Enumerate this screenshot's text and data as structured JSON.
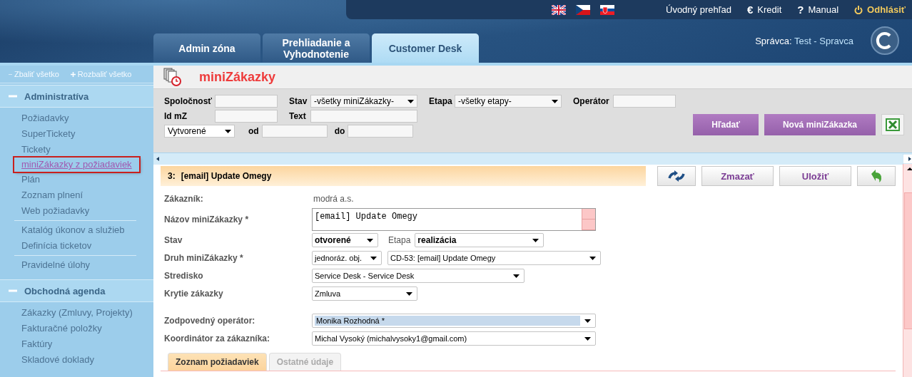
{
  "top_links": [
    {
      "kind": "plain",
      "label": "Úvodný prehľad"
    },
    {
      "kind": "glyph",
      "icon": "€",
      "label": "Kredit"
    },
    {
      "kind": "glyph",
      "icon": "?",
      "label": "Manual"
    },
    {
      "kind": "logout",
      "label": "Odhlásiť"
    }
  ],
  "tabs": [
    {
      "label": "Admin zóna",
      "selected": false
    },
    {
      "label": "Prehliadanie a Vyhodnotenie",
      "selected": false
    },
    {
      "label": "Customer Desk",
      "selected": true
    }
  ],
  "user": {
    "role": "Správca:",
    "name": "Test - Spravca"
  },
  "sidebar": {
    "collapse_all": "Zbaliť všetko",
    "expand_all": "Rozbaliť všetko",
    "sections": [
      {
        "title": "Administratíva",
        "expanded": true,
        "groups": [
          [
            {
              "label": "Požiadavky",
              "selected": false
            },
            {
              "label": "SuperTickety",
              "selected": false
            },
            {
              "label": "Tickety",
              "selected": false
            },
            {
              "label": "miniZákazky z požiadaviek",
              "selected": true
            },
            {
              "label": "Plán",
              "selected": false
            },
            {
              "label": "Zoznam plnení",
              "selected": false
            },
            {
              "label": "Web požiadavky",
              "selected": false
            }
          ],
          [
            {
              "label": "Katalóg úkonov a služieb",
              "selected": false
            },
            {
              "label": "Definícia ticketov",
              "selected": false
            }
          ],
          [
            {
              "label": "Pravidelné úlohy",
              "selected": false
            }
          ]
        ]
      },
      {
        "title": "Obchodná agenda",
        "expanded": true,
        "groups": [
          [
            {
              "label": "Zákazky (Zmluvy, Projekty)",
              "selected": false
            },
            {
              "label": "Fakturačné položky",
              "selected": false
            },
            {
              "label": "Faktúry",
              "selected": false
            },
            {
              "label": "Skladové doklady",
              "selected": false
            }
          ]
        ]
      }
    ]
  },
  "page": {
    "title": "miniZákazky"
  },
  "filters": {
    "fields": [
      {
        "label": "Spoločnosť",
        "kind": "input"
      },
      {
        "label": "Stav",
        "kind": "select",
        "value": "-všetky miniZákazky-"
      },
      {
        "label": "Etapa",
        "kind": "select",
        "value": "-všetky etapy-"
      },
      {
        "label": "Operátor",
        "kind": "input"
      },
      {
        "label": "Id mZ",
        "kind": "input"
      },
      {
        "label": "Text",
        "kind": "input"
      }
    ],
    "date": {
      "select": "Vytvorené",
      "from_label": "od",
      "to_label": "do"
    },
    "buttons": [
      {
        "label": "Hľadať"
      },
      {
        "label": "Nová miniZákazka"
      }
    ]
  },
  "record": {
    "number": "3:",
    "title": "[email] Update Omegy",
    "actions": [
      {
        "kind": "swap"
      },
      {
        "kind": "text",
        "label": "Zmazať"
      },
      {
        "kind": "text",
        "label": "Uložiť"
      },
      {
        "kind": "back"
      }
    ],
    "fields": [
      {
        "label": "Zákazník:",
        "controls": [
          {
            "kind": "static",
            "value": "modrá a.s."
          }
        ]
      },
      {
        "label": "Názov miniZákazky *",
        "controls": [
          {
            "kind": "textarea",
            "value": "[email] Update Omegy"
          }
        ]
      },
      {
        "label": "Stav",
        "controls": [
          {
            "kind": "select",
            "value": "otvorené",
            "bold": true
          },
          {
            "kind": "select",
            "label": "Etapa",
            "value": "realizácia",
            "bold": true
          }
        ]
      },
      {
        "label": "Druh miniZákazky *",
        "controls": [
          {
            "kind": "select",
            "value": "jednoráz. obj."
          },
          {
            "kind": "select",
            "value": "CD-53: [email] Update Omegy"
          }
        ]
      },
      {
        "label": "Stredisko",
        "controls": [
          {
            "kind": "select",
            "value": "Service Desk - Service Desk"
          }
        ]
      },
      {
        "label": "Krytie zákazky",
        "controls": [
          {
            "kind": "select",
            "value": "Zmluva"
          }
        ]
      },
      {
        "label": "Zodpovedný operátor:",
        "controls": [
          {
            "kind": "select",
            "value": "Monika Rozhodná *",
            "highlighted": true
          }
        ]
      },
      {
        "label": "Koordinátor za zákazníka:",
        "controls": [
          {
            "kind": "select",
            "value": "Michal Vysoký (michalvysoky1@gmail.com)"
          }
        ]
      }
    ],
    "tabs": [
      {
        "label": "Zoznam požiadaviek",
        "selected": true
      },
      {
        "label": "Ostatné údaje",
        "selected": false
      }
    ]
  }
}
